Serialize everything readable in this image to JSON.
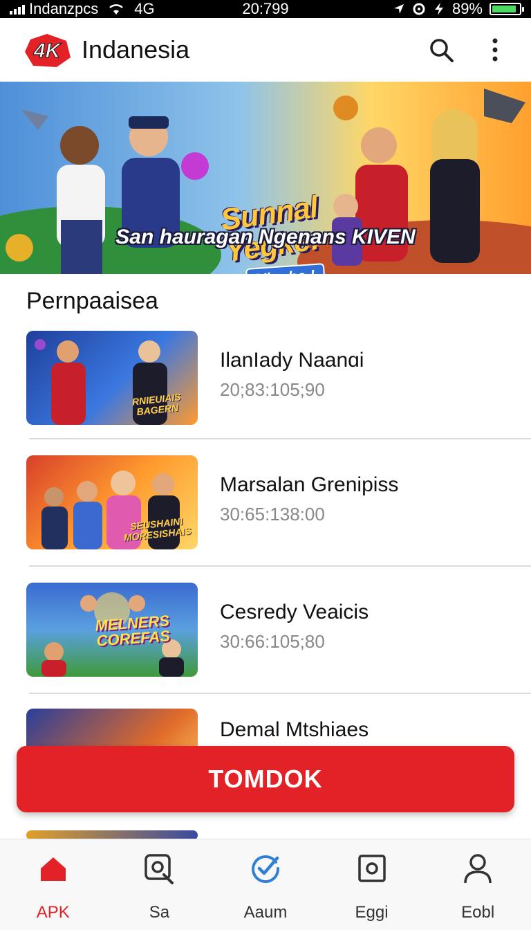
{
  "status_bar": {
    "carrier": "Indanzpcs",
    "network": "4G",
    "time": "20:799",
    "battery": "89%"
  },
  "header": {
    "title": "Indanesia",
    "logo_text": "4K",
    "search_icon": "search-icon",
    "menu_icon": "more-vertical-icon"
  },
  "banner": {
    "title_line1": "Sunnal",
    "title_line2": "Yegke:",
    "badge": "Vlaobe.!",
    "caption": "San hauragan Ngenans KIVEN"
  },
  "section": {
    "title": "Pernpaaisea"
  },
  "items": [
    {
      "title": "IlanIady Naanɑi",
      "meta": "20;83:105;90",
      "thumb_text": "RNIEUIAIS BAGERN"
    },
    {
      "title": "Marsalan Grenipiss",
      "meta": "30:65:138:00",
      "thumb_text": "SEUSHAINI MORESISHAIS"
    },
    {
      "title": "Cesredy Veaicis",
      "meta": "30:66:105;80",
      "thumb_text": "MELNERS COREFAS"
    },
    {
      "title": "Demal Mtshiaes",
      "meta": "",
      "thumb_text": ""
    }
  ],
  "cta": {
    "label": "TOMDOK"
  },
  "bottom_nav": [
    {
      "label": "APK",
      "icon": "home-icon",
      "active": true
    },
    {
      "label": "Sa",
      "icon": "search-square-icon",
      "active": false
    },
    {
      "label": "Aaum",
      "icon": "check-circle-icon",
      "active": false
    },
    {
      "label": "Eggi",
      "icon": "camera-square-icon",
      "active": false
    },
    {
      "label": "Eobl",
      "icon": "user-icon",
      "active": false
    }
  ],
  "colors": {
    "accent": "#e32227",
    "text": "#111111",
    "muted": "#888888",
    "nav_check": "#2f7fd4"
  }
}
